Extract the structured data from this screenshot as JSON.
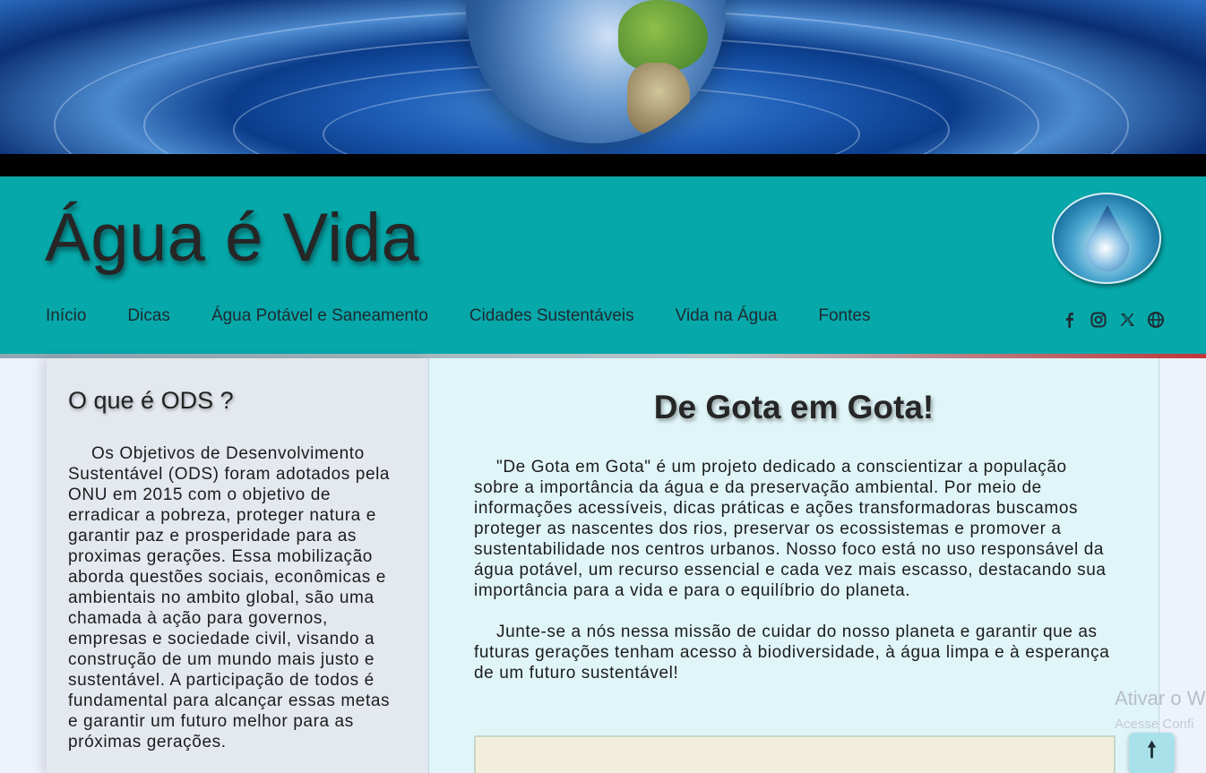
{
  "header": {
    "title": "Água é Vida",
    "nav": [
      "Início",
      "Dicas",
      "Água Potável e Saneamento",
      "Cidades Sustentáveis",
      "Vida na Água",
      "Fontes"
    ],
    "social_icons": [
      "facebook-icon",
      "instagram-icon",
      "x-icon",
      "globe-icon"
    ]
  },
  "sidebar": {
    "title": "O que é ODS ?",
    "text": "Os Objetivos de Desenvolvimento Sustentável (ODS) foram adotados pela ONU em 2015 com o objetivo de erradicar a pobreza, proteger natura e garantir paz e prosperidade para as proximas gerações. Essa mobilização aborda questões sociais, econômicas e ambientais no ambito global, são uma chamada à ação para governos, empresas e sociedade civil, visando a construção de um mundo mais justo e sustentável. A participação de todos é fundamental para alcançar essas metas e garantir um futuro melhor para as próximas gerações."
  },
  "main": {
    "title": "De Gota em Gota!",
    "paragraphs": [
      "\"De Gota em Gota\" é um projeto dedicado a conscientizar a população sobre a importância da água e da preservação ambiental. Por meio de informações acessíveis, dicas práticas e ações transformadoras buscamos proteger as nascentes dos rios, preservar os ecossistemas e promover a sustentabilidade nos centros urbanos. Nosso foco está no uso responsável da água potável, um recurso essencial e cada vez mais escasso, destacando sua importância para a vida e para o equilíbrio do planeta.",
      "Junte-se a nós nessa missão de cuidar do nosso planeta e garantir que as futuras gerações tenham acesso à biodiversidade, à água limpa e à esperança de um futuro sustentável!"
    ]
  },
  "overlay": {
    "watermark_title": "Ativar o W",
    "watermark_sub": "Acesse Confi",
    "back_to_top": "🠕"
  },
  "colors": {
    "header_bg": "#06a8aa",
    "sidebar_bg": "#e4e8ef",
    "main_bg": "#e0f5f8"
  }
}
